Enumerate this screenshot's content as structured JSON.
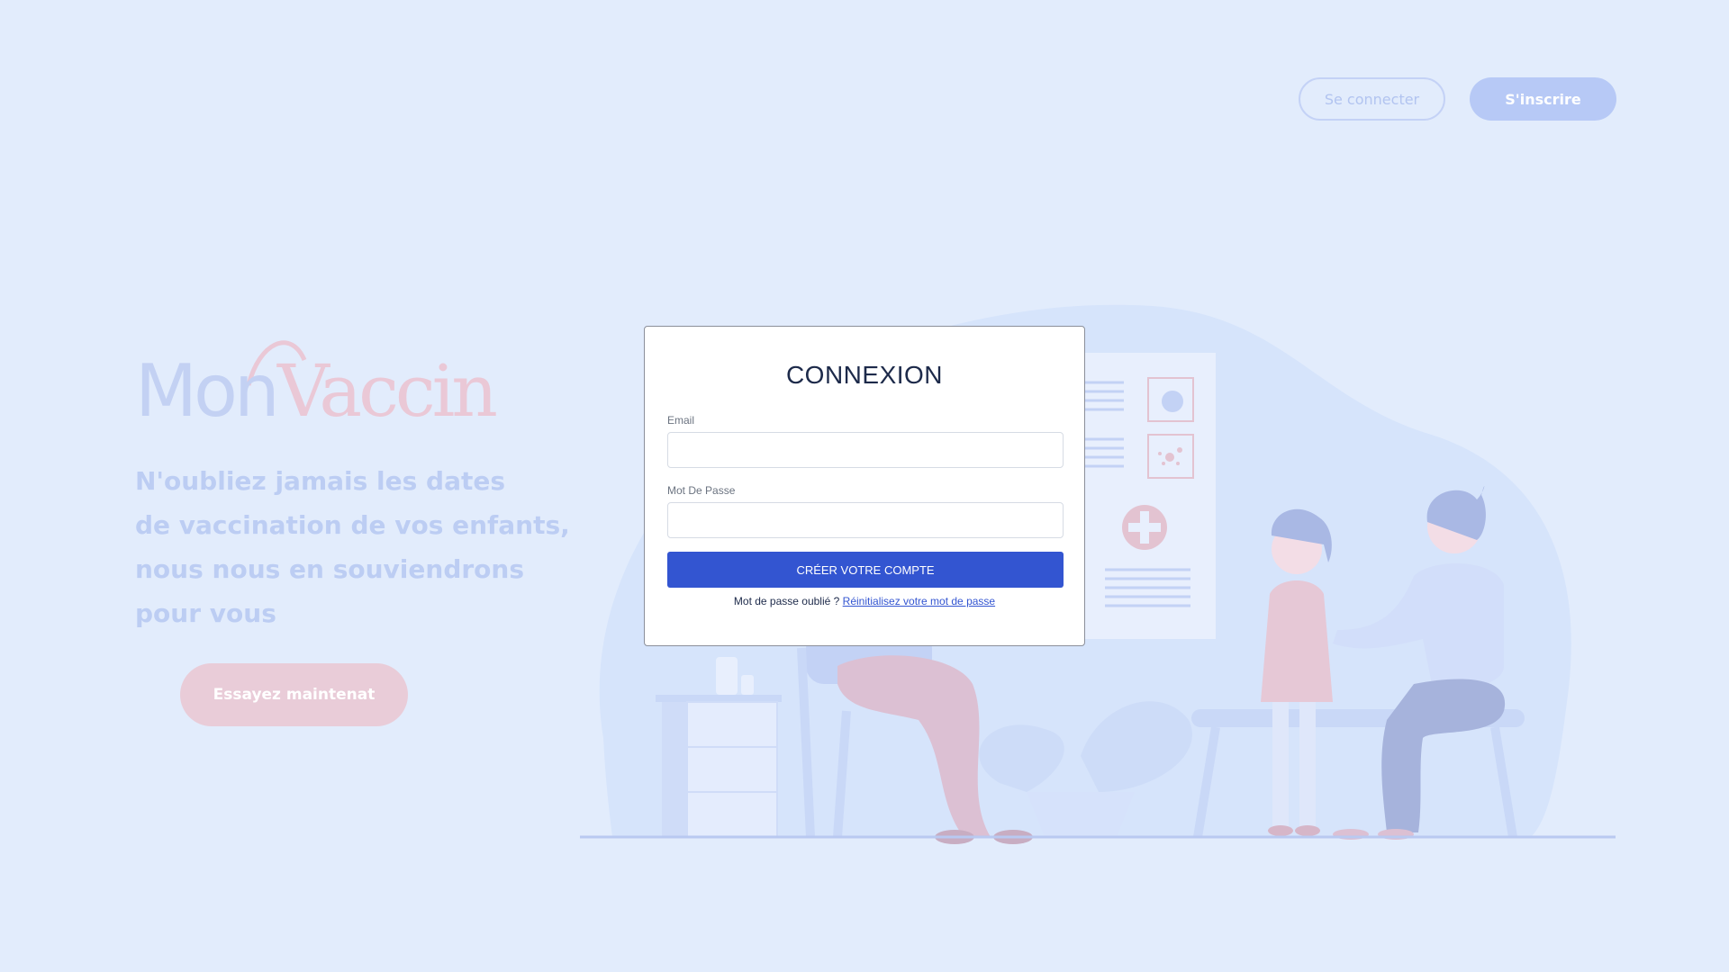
{
  "header": {
    "login_label": "Se connecter",
    "signup_label": "S'inscrire"
  },
  "logo": {
    "part1": "Mon",
    "part2": "Vaccin"
  },
  "hero": {
    "tagline_lines": [
      "N'oubliez jamais les dates",
      "de vaccination de vos enfants,",
      "nous nous en souviendrons",
      "pour vous"
    ],
    "cta_label": "Essayez maintenat"
  },
  "login_form": {
    "title": "CONNEXION",
    "email_label": "Email",
    "email_value": "",
    "password_label": "Mot De Passe",
    "password_value": "",
    "submit_label": "CRÉER VOTRE COMPTE",
    "forgot_text": "Mot de passe oublié ?",
    "reset_link": "Réinitialisez votre mot de passe"
  },
  "colors": {
    "background": "#e2ecfc",
    "primary": "#3355d1",
    "pink_accent": "#e9ccd8",
    "blue_accent": "#b7c9f6"
  },
  "illustration": {
    "icon": "vaccination-clinic-illustration"
  }
}
